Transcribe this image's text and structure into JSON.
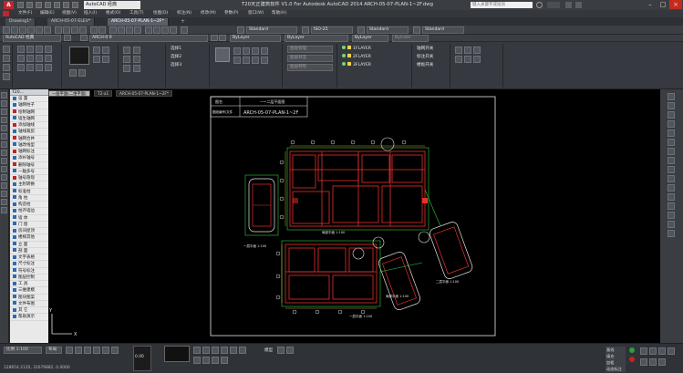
{
  "titlebar": {
    "workspace": "AutoCAD 经典",
    "title": "T20天正建筑软件 V1.0 For Autodesk AutoCAD 2014    ARCH-05-07-PLAN-1~2F.dwg",
    "search_placeholder": "键入关键字或短语",
    "logo": "A"
  },
  "menu": [
    "文件(F)",
    "编辑(E)",
    "视图(V)",
    "插入(I)",
    "格式(O)",
    "工具(T)",
    "绘图(D)",
    "标注(N)",
    "修改(M)",
    "参数(P)",
    "窗口(W)",
    "帮助(H)"
  ],
  "doc_tabs": [
    "Drawing1*",
    "ARCH-05-07-ELEV*",
    "ARCH-05-07-PLAN-1~2F*"
  ],
  "toolbar": {
    "workspace_combo": "AutoCAD 经典",
    "text_style": "Standard",
    "dim_style": "ISO-25",
    "table_style": "Standard",
    "mleader_style": "Standard",
    "layer_combo": "ARCH-0 0",
    "color_combo": "ByLayer",
    "linetype_combo": "ByLayer",
    "lineweight_combo": "ByLayer",
    "plot_combo": "ByColor"
  },
  "ribbon": {
    "layers": [
      "1FLAYER",
      "2FLAYER",
      "3FLAYER"
    ],
    "layer_labels": [
      "轴网开关",
      "标注开关",
      "楼板开关"
    ],
    "view_labels": [
      "选择1",
      "选择2",
      "选择3"
    ],
    "misc": [
      "图层管理",
      "图层状态",
      "图层特性"
    ]
  },
  "tpanel": {
    "header": "T20...",
    "items": [
      {
        "label": "设  置",
        "red": false
      },
      {
        "label": "轴网柱子",
        "red": false
      },
      {
        "label": "绘制轴网",
        "red": true
      },
      {
        "label": "墙生轴网",
        "red": false
      },
      {
        "label": "添加轴线",
        "red": true
      },
      {
        "label": "轴线裁剪",
        "red": false
      },
      {
        "label": "轴网合并",
        "red": true
      },
      {
        "label": "轴改线型",
        "red": false
      },
      {
        "label": "轴网标注",
        "red": true
      },
      {
        "label": "添补轴号",
        "red": false
      },
      {
        "label": "删除轴号",
        "red": true
      },
      {
        "label": "一轴多号",
        "red": false
      },
      {
        "label": "轴号隐现",
        "red": true
      },
      {
        "label": "主附转换",
        "red": false
      },
      {
        "label": "标准柱",
        "red": false
      },
      {
        "label": "角  柱",
        "red": false
      },
      {
        "label": "构造柱",
        "red": false
      },
      {
        "label": "柱齐墙边",
        "red": false
      },
      {
        "label": "墙  体",
        "red": false
      },
      {
        "label": "门  窗",
        "red": false
      },
      {
        "label": "房间屋顶",
        "red": false
      },
      {
        "label": "楼梯其他",
        "red": false
      },
      {
        "label": "立  面",
        "red": false
      },
      {
        "label": "剖  面",
        "red": false
      },
      {
        "label": "文字表格",
        "red": false
      },
      {
        "label": "尺寸标注",
        "red": false
      },
      {
        "label": "符号标注",
        "red": false
      },
      {
        "label": "图层控制",
        "red": false
      },
      {
        "label": "工  具",
        "red": false
      },
      {
        "label": "三维建模",
        "red": false
      },
      {
        "label": "图块图案",
        "red": false
      },
      {
        "label": "文件布图",
        "red": false
      },
      {
        "label": "其  它",
        "red": false
      },
      {
        "label": "帮助演示",
        "red": false
      }
    ]
  },
  "layout_tabs": [
    "一层平面(二维平面)",
    "T2-a1",
    "ARCH-05-07-PLAN-1~2F*"
  ],
  "drawing": {
    "title_box_left": "图名",
    "title_box_right": "一~二层平面图",
    "title_box_label": "图纸编号/文件",
    "title_box_code": "ARCH-05-07-PLAN-1~2F",
    "plan_labels": [
      "一层平面 1:100",
      "二层平面 1:100",
      "局部平面 1:100",
      "一层平面 1:100",
      "局部平面 1:100"
    ],
    "ucs_y": "Y",
    "ucs_x": "X"
  },
  "statusbar": {
    "scale_label": "比例 1:100",
    "coords": "128654.2120, 31679882, 0.0000",
    "layer_label": "布局",
    "model_label": "模型",
    "zoom": "0.00",
    "right_labels": [
      "基线",
      "填充",
      "加粗",
      "动态标注"
    ]
  },
  "colors": {
    "canvas": "#000000",
    "drawing_red": "#e8302e",
    "drawing_green": "#38c838",
    "drawing_white": "#e6e6e6",
    "drawing_yellow": "#e9d44a"
  }
}
